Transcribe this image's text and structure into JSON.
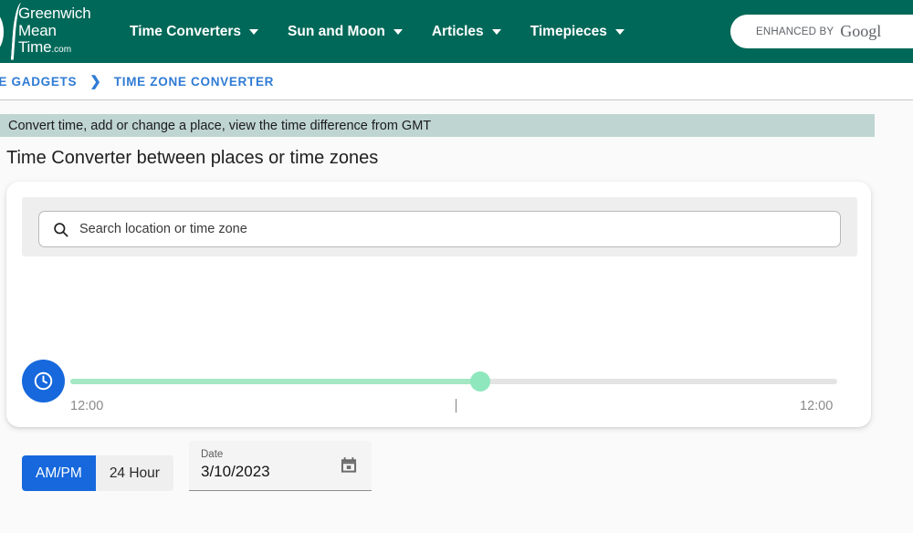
{
  "header": {
    "logo": {
      "line1": "Greenwich",
      "line2": "Mean",
      "line3": "Time",
      "suffix": ".com"
    },
    "nav": [
      {
        "label": "Time Converters",
        "has_caret": true
      },
      {
        "label": "Sun and Moon",
        "has_caret": true
      },
      {
        "label": "Articles",
        "has_caret": true
      },
      {
        "label": "Timepieces",
        "has_caret": true
      }
    ],
    "google_search": {
      "enhanced_label": "ENHANCED BY",
      "brand": "Googl",
      "icon": "google-branding"
    },
    "background_color": "#006858"
  },
  "breadcrumb": {
    "items": [
      {
        "label": "IME GADGETS",
        "current": false
      },
      {
        "label": "TIME ZONE CONVERTER",
        "current": true
      }
    ],
    "separator": "›",
    "link_color": "#2f7bd4"
  },
  "notice": {
    "text": "Convert time, add or change a place, view the time difference from GMT",
    "background_color": "#bfd5d2"
  },
  "page_title": "Time Converter between places or time zones",
  "card": {
    "search": {
      "placeholder": "Search location or time zone",
      "icon": "search-icon"
    },
    "slider": {
      "clock_button_icon": "clock-icon",
      "clock_button_color": "#1668dc",
      "label_start": "12:00",
      "label_end": "12:00",
      "fill_color": "#a5e8c4",
      "thumb_color": "#8fe7bd",
      "track_color": "#e4e4e4",
      "value_percent": 53
    },
    "format_toggle": {
      "options": [
        {
          "label": "AM/PM",
          "selected": true
        },
        {
          "label": "24 Hour",
          "selected": false
        }
      ],
      "active_color": "#1668dc"
    },
    "date_field": {
      "label": "Date",
      "value": "3/10/2023",
      "icon": "calendar-icon"
    }
  }
}
